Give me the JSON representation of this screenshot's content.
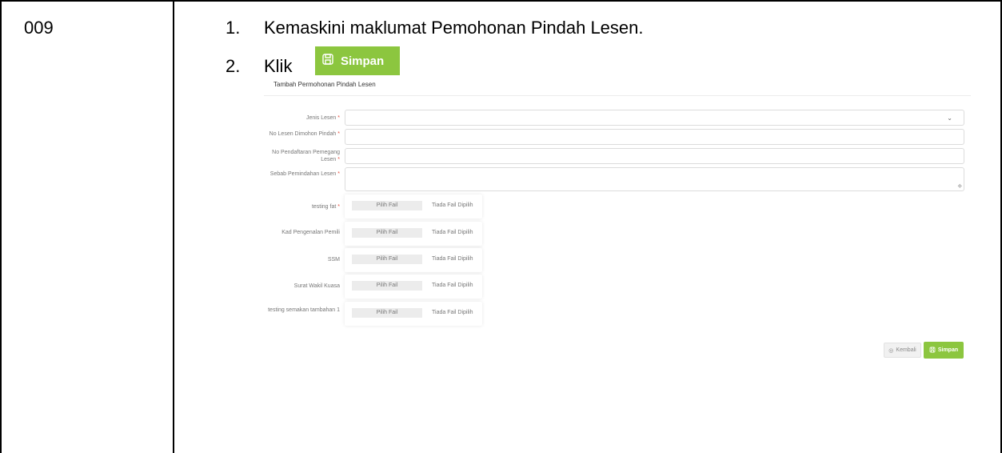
{
  "table": {
    "step_id": "009"
  },
  "steps": [
    {
      "num": "1.",
      "text": "Kemaskini maklumat Pemohonan Pindah Lesen."
    },
    {
      "num": "2.",
      "text": "Klik"
    }
  ],
  "inline_button": {
    "label": "Simpan",
    "icon": "save-icon"
  },
  "form": {
    "title": "Tambah Permohonan Pindah Lesen",
    "required_mark": "*",
    "fields": [
      {
        "label": "Jenis Lesen",
        "value": ""
      },
      {
        "label": "No Lesen Dimohon Pindah",
        "value": ""
      },
      {
        "label": "No Pendaftaran Pemegang Lesen",
        "value": ""
      },
      {
        "label": "Sebab Pemindahan Lesen",
        "value": ""
      }
    ],
    "uploads": [
      {
        "label": "testing fat",
        "button": "Pilih Fail",
        "status": "Tiada Fail Dipilih"
      },
      {
        "label": "Kad Pengenalan Pemili",
        "button": "Pilih Fail",
        "status": "Tiada Fail Dipilih"
      },
      {
        "label": "SSM",
        "button": "Pilih Fail",
        "status": "Tiada Fail Dipilih"
      },
      {
        "label": "Surat Wakil Kuasa",
        "button": "Pilih Fail",
        "status": "Tiada Fail Dipilih"
      },
      {
        "label": "testing semakan tambahan 1",
        "button": "Pilih Fail",
        "status": "Tiada Fail Dipilih"
      }
    ],
    "actions": {
      "back_label": "Kembali",
      "save_label": "Simpan"
    }
  },
  "colors": {
    "accent": "#8cc63f",
    "required": "#e74c3c"
  }
}
